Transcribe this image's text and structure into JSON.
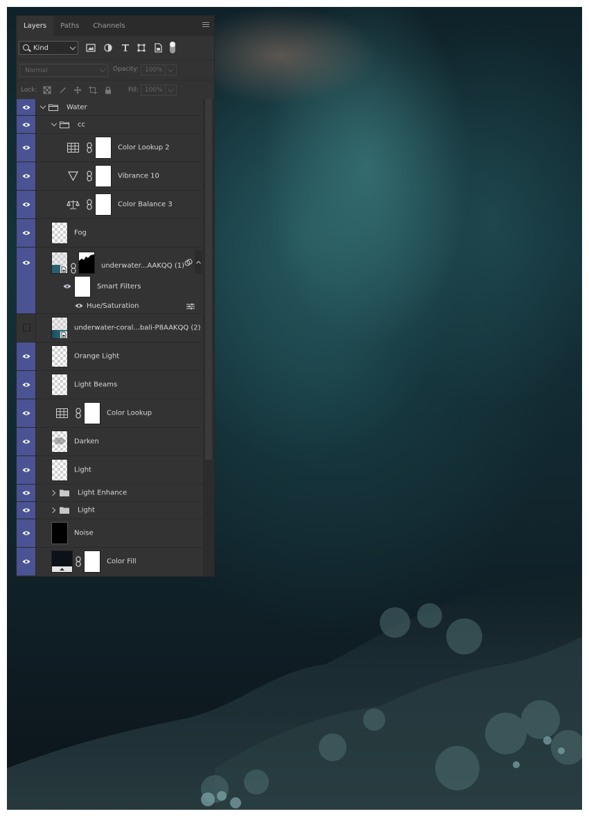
{
  "panel": {
    "tabs": [
      {
        "label": "Layers",
        "active": true
      },
      {
        "label": "Paths",
        "active": false
      },
      {
        "label": "Channels",
        "active": false
      }
    ],
    "filter": {
      "kind_label": "Kind"
    },
    "blend_mode": "Normal",
    "opacity_label": "Opacity:",
    "opacity_value": "100%",
    "lock_label": "Lock:",
    "fill_label": "Fill:",
    "fill_value": "100%"
  },
  "layers": {
    "water": "Water",
    "cc": "cc",
    "color_lookup_2": "Color Lookup 2",
    "vibrance_10": "Vibrance 10",
    "color_balance_3": "Color Balance 3",
    "fog": "Fog",
    "underwater_1": "underwater...AAKQQ (1)",
    "smart_filters": "Smart Filters",
    "hue_saturation": "Hue/Saturation",
    "underwater_2": "underwater-coral...bali-P8AAKQQ (2)",
    "orange_light": "Orange Light",
    "light_beams": "Light Beams",
    "color_lookup": "Color Lookup",
    "darken": "Darken",
    "light": "Light",
    "light_enhance": "Light Enhance",
    "light_group": "Light",
    "noise": "Noise",
    "color_fill": "Color Fill"
  },
  "colors": {
    "visibility_column": "#4a5394",
    "panel_bg": "#333333"
  }
}
